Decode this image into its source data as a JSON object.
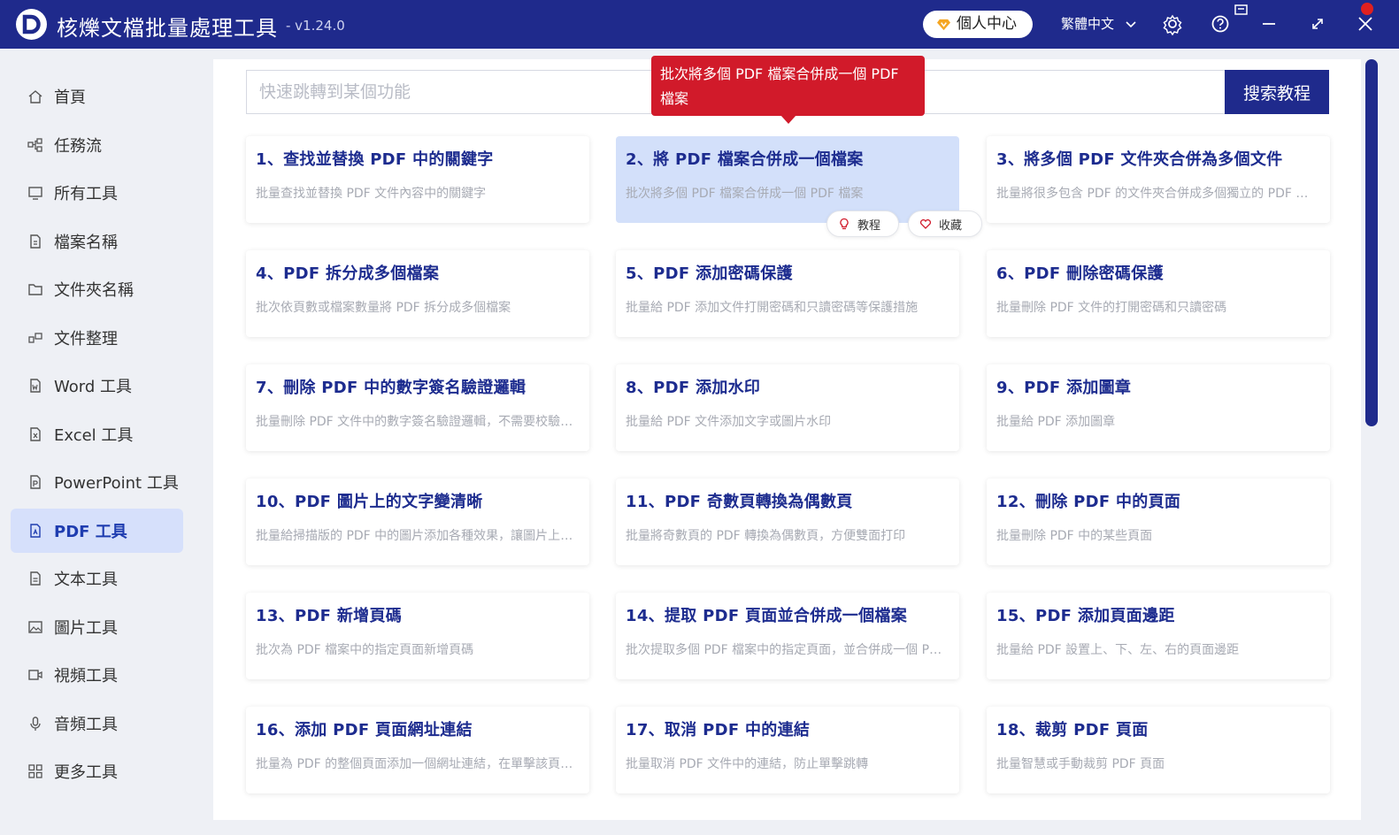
{
  "app": {
    "title": "核爍文檔批量處理工具",
    "version": "- v1.24.0",
    "personal_center": "個人中心",
    "language": "繁體中文"
  },
  "sidebar": {
    "items": [
      {
        "label": "首頁",
        "icon": "home-icon"
      },
      {
        "label": "任務流",
        "icon": "workflow-icon"
      },
      {
        "label": "所有工具",
        "icon": "monitor-icon"
      },
      {
        "label": "檔案名稱",
        "icon": "file-name-icon"
      },
      {
        "label": "文件夾名稱",
        "icon": "folder-icon"
      },
      {
        "label": "文件整理",
        "icon": "organize-icon"
      },
      {
        "label": "Word 工具",
        "icon": "word-icon"
      },
      {
        "label": "Excel 工具",
        "icon": "excel-icon"
      },
      {
        "label": "PowerPoint 工具",
        "icon": "powerpoint-icon"
      },
      {
        "label": "PDF 工具",
        "icon": "pdf-icon",
        "active": true
      },
      {
        "label": "文本工具",
        "icon": "text-icon"
      },
      {
        "label": "圖片工具",
        "icon": "image-icon"
      },
      {
        "label": "視頻工具",
        "icon": "video-icon"
      },
      {
        "label": "音頻工具",
        "icon": "audio-icon"
      },
      {
        "label": "更多工具",
        "icon": "grid-icon"
      }
    ]
  },
  "search": {
    "placeholder": "快速跳轉到某個功能",
    "button": "搜索教程"
  },
  "tooltip": "批次將多個 PDF 檔案合併成一個 PDF 檔案",
  "chips": {
    "tutorial": "教程",
    "favorite": "收藏"
  },
  "cards": [
    {
      "title": "1、查找並替換 PDF 中的關鍵字",
      "desc": "批量查找並替換 PDF 文件內容中的關鍵字"
    },
    {
      "title": "2、將 PDF 檔案合併成一個檔案",
      "desc": "批次將多個 PDF 檔案合併成一個 PDF 檔案",
      "hover": true
    },
    {
      "title": "3、將多個 PDF 文件夾合併為多個文件",
      "desc": "批量將很多包含 PDF 的文件夾合併成多個獨立的 PDF 文件"
    },
    {
      "title": "4、PDF 拆分成多個檔案",
      "desc": "批次依頁數或檔案數量將 PDF 拆分成多個檔案"
    },
    {
      "title": "5、PDF 添加密碼保護",
      "desc": "批量給 PDF 添加文件打開密碼和只讀密碼等保護措施"
    },
    {
      "title": "6、PDF 刪除密碼保護",
      "desc": "批量刪除 PDF 文件的打開密碼和只讀密碼"
    },
    {
      "title": "7、刪除 PDF 中的數字簽名驗證邏輯",
      "desc": "批量刪除 PDF 文件中的數字簽名驗證邏輯，不需要校驗簽名"
    },
    {
      "title": "8、PDF 添加水印",
      "desc": "批量給 PDF 文件添加文字或圖片水印"
    },
    {
      "title": "9、PDF 添加圖章",
      "desc": "批量給 PDF 添加圖章"
    },
    {
      "title": "10、PDF 圖片上的文字變清晰",
      "desc": "批量給掃描版的 PDF 中的圖片添加各種效果，讓圖片上的文字變清晰"
    },
    {
      "title": "11、PDF 奇數頁轉換為偶數頁",
      "desc": "批量將奇數頁的 PDF 轉換為偶數頁，方便雙面打印"
    },
    {
      "title": "12、刪除 PDF 中的頁面",
      "desc": "批量刪除 PDF 中的某些頁面"
    },
    {
      "title": "13、PDF 新增頁碼",
      "desc": "批次為 PDF 檔案中的指定頁面新增頁碼"
    },
    {
      "title": "14、提取 PDF 頁面並合併成一個檔案",
      "desc": "批次提取多個 PDF 檔案中的指定頁面，並合併成一個 PDF 檔案"
    },
    {
      "title": "15、PDF 添加頁面邊距",
      "desc": "批量給 PDF 設置上、下、左、右的頁面邊距"
    },
    {
      "title": "16、添加 PDF 頁面網址連結",
      "desc": "批量為 PDF 的整個頁面添加一個網址連結，在單擊該頁面時跳轉"
    },
    {
      "title": "17、取消 PDF 中的連結",
      "desc": "批量取消 PDF 文件中的連結，防止單擊跳轉"
    },
    {
      "title": "18、裁剪 PDF 頁面",
      "desc": "批量智慧或手動裁剪 PDF 頁面"
    }
  ]
}
